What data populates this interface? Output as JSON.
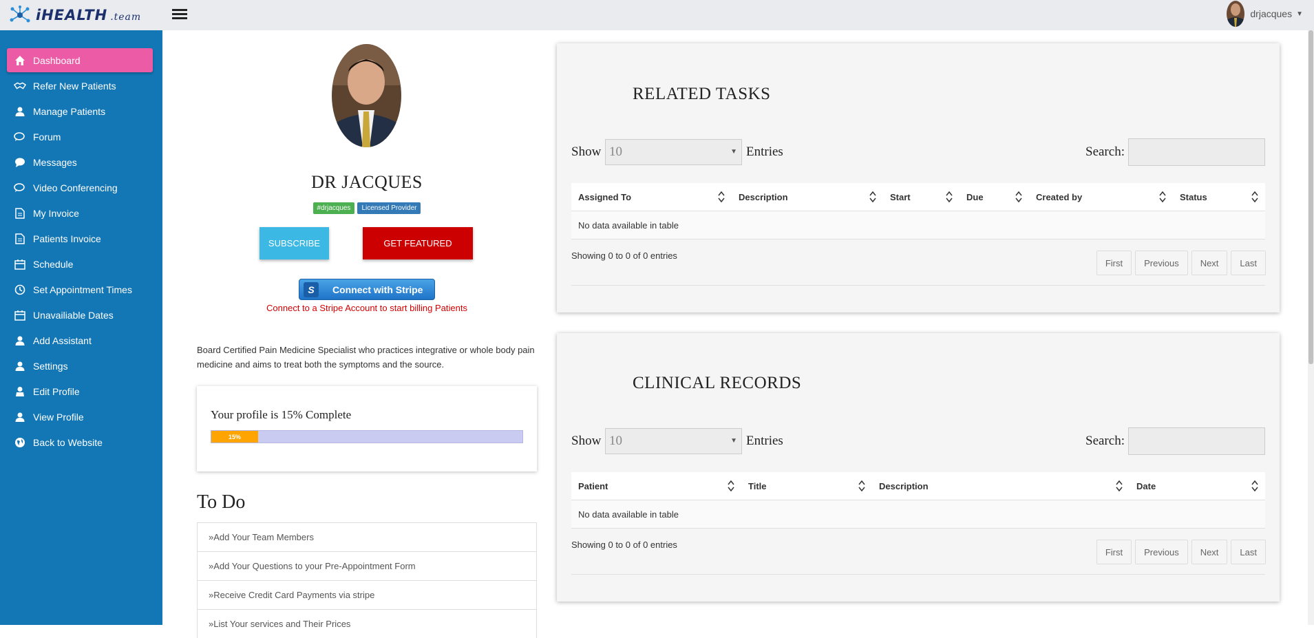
{
  "brand": {
    "name": "iHEALTH",
    "suffix": ".team"
  },
  "user": {
    "name": "drjacques"
  },
  "sidebar": {
    "items": [
      {
        "label": "Dashboard",
        "icon": "home-icon"
      },
      {
        "label": "Refer New Patients",
        "icon": "handshake-icon"
      },
      {
        "label": "Manage Patients",
        "icon": "user-icon"
      },
      {
        "label": "Forum",
        "icon": "comments-icon"
      },
      {
        "label": "Messages",
        "icon": "chat-bubble-icon"
      },
      {
        "label": "Video Conferencing",
        "icon": "comments-icon"
      },
      {
        "label": "My Invoice",
        "icon": "document-icon"
      },
      {
        "label": "Patients Invoice",
        "icon": "document-icon"
      },
      {
        "label": "Schedule",
        "icon": "calendar-icon"
      },
      {
        "label": "Set Appointment Times",
        "icon": "clock-icon"
      },
      {
        "label": "Unavailiable Dates",
        "icon": "calendar-icon"
      },
      {
        "label": "Add Assistant",
        "icon": "user-icon"
      },
      {
        "label": "Settings",
        "icon": "user-icon"
      },
      {
        "label": "Edit Profile",
        "icon": "user-edit-icon"
      },
      {
        "label": "View Profile",
        "icon": "user-icon"
      },
      {
        "label": "Back to Website",
        "icon": "globe-icon"
      }
    ]
  },
  "profile": {
    "name": "DR JACQUES",
    "badges": [
      "#drjacques",
      "Licensed Provider"
    ],
    "subscribe_label": "SUBSCRIBE",
    "featured_label": "GET FEATURED",
    "stripe_button": "Connect with Stripe",
    "stripe_note": "Connect to a Stripe Account to start billing Patients",
    "bio": "Board Certified Pain Medicine Specialist who practices integrative or whole body pain medicine and aims to treat both the symptoms and the source.",
    "progress_title": "Your profile is 15% Complete",
    "progress_percent": 15,
    "progress_label": "15%"
  },
  "todo": {
    "title": "To Do",
    "items": [
      "Add Your Team Members",
      "Add Your Questions to your Pre-Appointment Form",
      "Receive Credit Card Payments via stripe",
      "List Your services and Their Prices"
    ]
  },
  "tasks": {
    "title": "RELATED TASKS",
    "show_label": "Show",
    "entries_value": "10",
    "entries_label": "Entries",
    "search_label": "Search:",
    "columns": [
      "Assigned To",
      "Description",
      "Start",
      "Due",
      "Created by",
      "Status"
    ],
    "empty_text": "No data available in table",
    "showing_text": "Showing 0 to 0 of 0 entries",
    "pager": [
      "First",
      "Previous",
      "Next",
      "Last"
    ]
  },
  "records": {
    "title": "CLINICAL RECORDS",
    "show_label": "Show",
    "entries_value": "10",
    "entries_label": "Entries",
    "search_label": "Search:",
    "columns": [
      "Patient",
      "Title",
      "Description",
      "Date"
    ],
    "empty_text": "No data available in table",
    "showing_text": "Showing 0 to 0 of 0 entries",
    "pager": [
      "First",
      "Previous",
      "Next",
      "Last"
    ]
  },
  "colors": {
    "sidebar": "#1376b5",
    "active": "#ec5ba6",
    "subscribe": "#3bb8e3",
    "featured": "#cc0000",
    "progress": "#ffa400"
  }
}
